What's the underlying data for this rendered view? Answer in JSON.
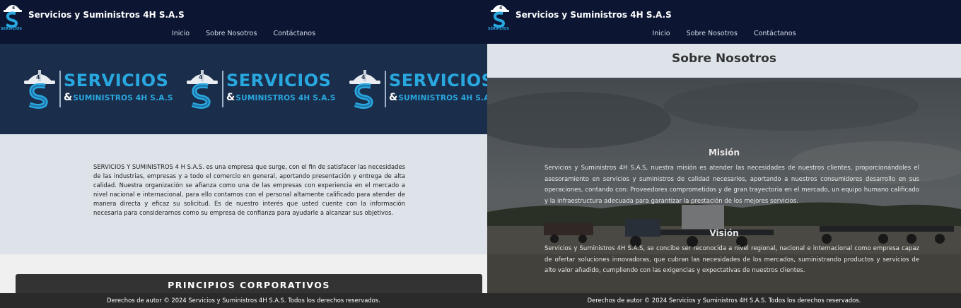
{
  "left_page": {
    "navbar": {
      "brand_name": "Servicios y Suministros 4H S.A.S",
      "links": [
        "Inicio",
        "Sobre Nosotros",
        "Contáctanos"
      ]
    },
    "hero": {
      "logo_word1": "SERVICIOS",
      "logo_amp": "&",
      "logo_word2": "SUMINISTROS 4H S.A.S"
    },
    "intro_text": "SERVICIOS Y SUMINISTROS 4 H S.A.S. es una empresa que surge, con el fin de satisfacer las necesidades de las industrias, empresas y a todo el comercio en general, aportando presentación y entrega de alta calidad. Nuestra organización se afianza como una de las empresas con experiencia en el mercado a nivel nacional e internacional, para ello contamos con el personal altamente calificado para atender de manera directa y eficaz su solicitud. Es de nuestro interés que usted cuente con la información necesaria para considerarnos como su empresa de confianza para ayudarle a alcanzar sus objetivos.",
    "principles_title": "PRINCIPIOS CORPORATIVOS",
    "footer": "Derechos de autor © 2024 Servicios y Suministros 4H S.A.S. Todos los derechos reservados."
  },
  "right_page": {
    "navbar": {
      "brand_name": "Servicios y Suministros 4H S.A.S",
      "links": [
        "Inicio",
        "Sobre Nosotros",
        "Contáctanos"
      ]
    },
    "title": "Sobre Nosotros",
    "mision_title": "Misión",
    "mision_text": "Servicios y Suministros 4H S.A.S, nuestra misión es atender las necesidades de nuestros clientes, proporcionándoles el asesoramiento en servicios y suministros de calidad necesarios, aportando a nuestros consumidores desarrollo en sus operaciones, contando con: Proveedores comprometidos y de gran trayectoria en el mercado, un equipo humano calificado y la infraestructura adecuada para garantizar la prestación de los mejores servicios.",
    "vision_title": "Visión",
    "vision_text": "Servicios y Suministros 4H S.A.S, se concibe ser reconocida a nivel regional, nacional e internacional como empresa capaz de ofertar soluciones innovadoras, que cubran las necesidades de los mercados, suministrando productos y servicios de alto valor añadido, cumpliendo con las exigencias y expectativas de nuestros clientes.",
    "footer": "Derechos de autor © 2024 Servicios y Suministros 4H S.A.S. Todos los derechos reservados."
  },
  "colors": {
    "navbar": "#0c1633",
    "hero": "#1a2e4b",
    "logo_blue": "#29a8e0",
    "intro_bg": "#dde3e8",
    "footer": "#2a2a2a"
  },
  "icons": [
    "company-logo-icon",
    "hard-hat-icon"
  ]
}
